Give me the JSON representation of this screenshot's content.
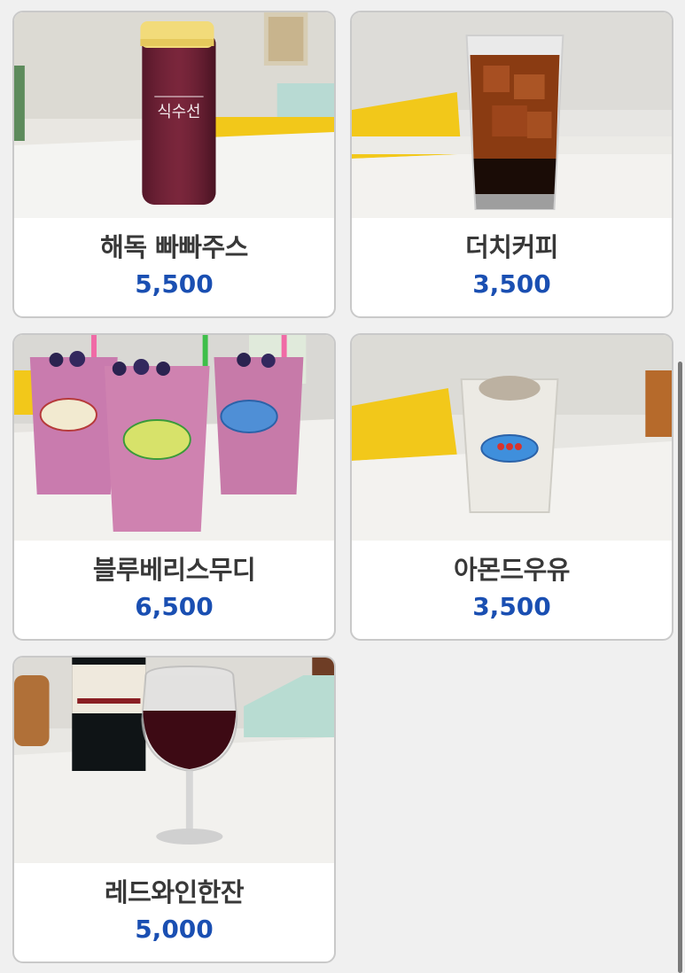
{
  "menu": {
    "items": [
      {
        "name": "해독 빠빠주스",
        "price": "5,500",
        "photo": "detox-juice-bottle"
      },
      {
        "name": "더치커피",
        "price": "3,500",
        "photo": "iced-dutch-coffee"
      },
      {
        "name": "블루베리스무디",
        "price": "6,500",
        "photo": "blueberry-smoothies"
      },
      {
        "name": "아몬드우유",
        "price": "3,500",
        "photo": "almond-milk"
      },
      {
        "name": "레드와인한잔",
        "price": "5,000",
        "photo": "red-wine-glass"
      }
    ]
  },
  "bottle_label": "식수선",
  "colors": {
    "price": "#1a4fb2",
    "name": "#383838",
    "card_border": "#c9c9c9",
    "page_bg": "#f0f0f0",
    "chair_yellow": "#f2c81a"
  }
}
